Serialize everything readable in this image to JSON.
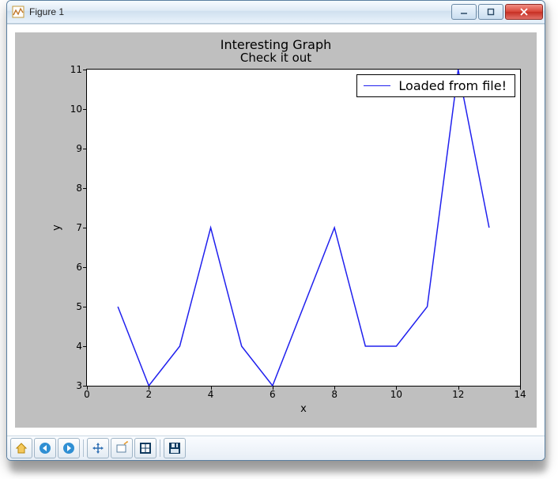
{
  "window": {
    "title": "Figure 1"
  },
  "toolbar": {
    "items": [
      "home",
      "back",
      "forward",
      "pan",
      "zoom",
      "subplots",
      "save"
    ]
  },
  "chart_data": {
    "type": "line",
    "title": "Interesting Graph",
    "subtitle": "Check it out",
    "xlabel": "x",
    "ylabel": "y",
    "xlim": [
      0,
      14
    ],
    "ylim": [
      3,
      11
    ],
    "xticks": [
      0,
      2,
      4,
      6,
      8,
      10,
      12,
      14
    ],
    "yticks": [
      3,
      4,
      5,
      6,
      7,
      8,
      9,
      10,
      11
    ],
    "series": [
      {
        "name": "Loaded from file!",
        "x": [
          1,
          2,
          3,
          4,
          5,
          6,
          7,
          8,
          9,
          10,
          11,
          12,
          13
        ],
        "y": [
          5,
          3,
          4,
          7,
          4,
          3,
          5,
          7,
          4,
          4,
          5,
          11,
          7
        ]
      }
    ],
    "legend_position": "upper right"
  }
}
